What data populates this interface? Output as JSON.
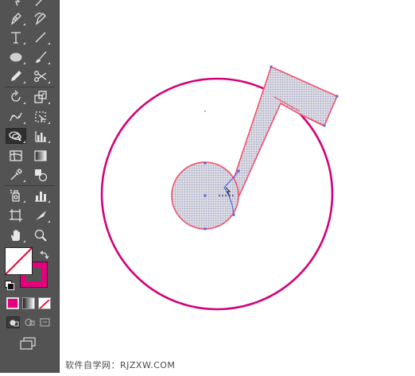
{
  "toolbar": {
    "tools": [
      "pen-tool",
      "curvature-tool",
      "type-tool",
      "line-segment-tool",
      "ellipse-tool",
      "paintbrush-tool",
      "pencil-tool",
      "scissors-tool",
      "rotate-tool",
      "scale-tool",
      "puppet-warp-tool",
      "free-transform-tool",
      "shape-builder-tool",
      "symbol-sprayer-tool",
      "mesh-tool",
      "gradient-tool",
      "eyedropper-tool",
      "blend-tool",
      "live-paint-bucket-tool",
      "column-graph-tool",
      "artboard-tool",
      "slice-tool",
      "hand-tool",
      "zoom-tool"
    ],
    "selected_tool": "shape-builder-tool",
    "fill": "none",
    "stroke_color": "#e6007e",
    "mode_buttons": [
      "color",
      "gradient",
      "none"
    ],
    "draw_modes": [
      "draw-normal",
      "draw-behind",
      "draw-inside"
    ]
  },
  "colors": {
    "circle_stroke": "#d4007a",
    "path_stroke": "#f0526b",
    "anchor": "#5566dd",
    "shape_fill": "#d8d8e2"
  },
  "watermark": {
    "text": "软件自学网：RJZXW.COM"
  }
}
